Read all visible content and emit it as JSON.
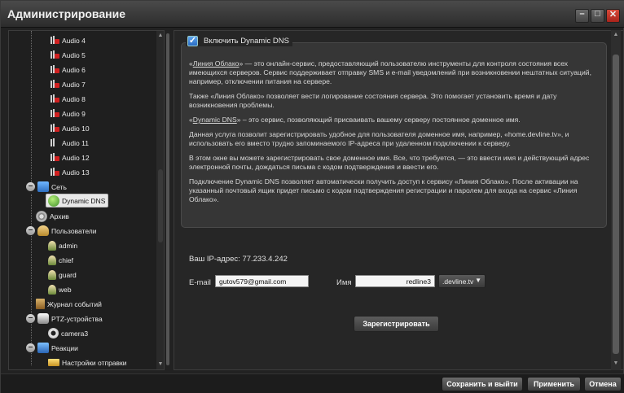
{
  "window": {
    "title": "Администрирование"
  },
  "tree": {
    "audio_items": [
      "Audio 4",
      "Audio 5",
      "Audio 6",
      "Audio 7",
      "Audio 8",
      "Audio 9",
      "Audio 10",
      "Audio 11",
      "Audio 12",
      "Audio 13"
    ],
    "network": "Сеть",
    "dynamic_dns": "Dynamic DNS",
    "archive": "Архив",
    "users": "Пользователи",
    "user_items": [
      "admin",
      "chief",
      "guard",
      "web"
    ],
    "event_log": "Журнал событий",
    "ptz": "PTZ-устройства",
    "ptz_items": [
      "camera3"
    ],
    "reactions": "Реакции",
    "send_settings": "Настройки отправки"
  },
  "dns": {
    "enable_label": "Включить Dynamic DNS",
    "enabled": true,
    "paragraphs": {
      "p1_link": "Линия Облако",
      "p1_open": "«",
      "p1_rest": "» — это онлайн-сервис, предоставляющий пользователю инструменты для контроля состояния всех имеющихся серверов. Сервис поддерживает отправку SMS и e-mail уведомлений при возникновении нештатных ситуаций, например, отключении питания на сервере.",
      "p2": "Также «Линия Облако» позволяет вести логирование состояния сервера. Это помогает установить время и дату возникновения проблемы.",
      "p3_open": "«",
      "p3_link": "Dynamic DNS",
      "p3_rest": "» – это сервис, позволяющий присваивать вашему серверу постоянное доменное имя.",
      "p4": "Данная услуга позволит зарегистрировать удобное для пользователя доменное имя, например, «home.devline.tv», и использовать его вместо трудно запоминаемого IP-адреса при удаленном подключении к серверу.",
      "p5": "В этом окне вы можете зарегистрировать свое доменное имя. Все, что требуется, — это ввести имя и действующий адрес электронной почты, дождаться письма с кодом подтверждения и ввести его.",
      "p6": "Подключение Dynamic DNS позволяет автоматически получить доступ к сервису «Линия Облако». После активации на указанный почтовый ящик придет письмо с кодом подтверждения регистрации и паролем для входа на сервис «Линия Облако»."
    },
    "ip_text": "Ваш IP-адрес: 77.233.4.242",
    "email_label": "E-mail",
    "email_value": "gutov579@gmail.com",
    "name_label": "Имя",
    "name_value": "redline3",
    "domain_selected": ".devline.tv",
    "register_label": "Зарегистрировать"
  },
  "buttons": {
    "save_exit": "Сохранить и выйти",
    "apply": "Применить",
    "cancel": "Отмена"
  }
}
